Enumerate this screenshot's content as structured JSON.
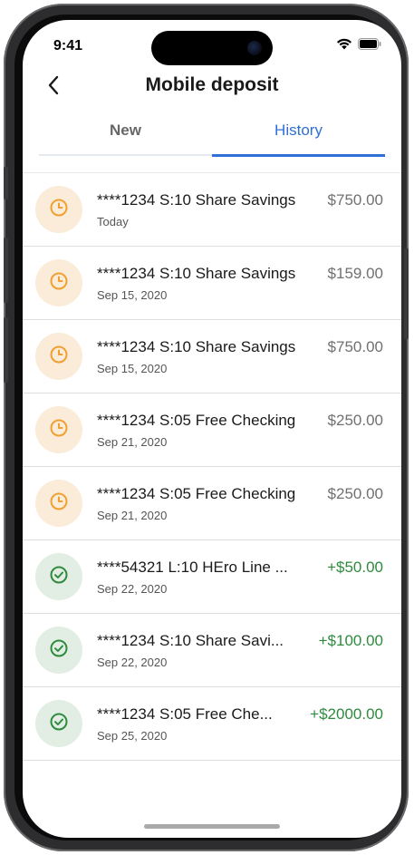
{
  "status_bar": {
    "time": "9:41"
  },
  "header": {
    "title": "Mobile deposit",
    "back_icon": "chevron-left-icon"
  },
  "tabs": [
    {
      "label": "New",
      "active": false
    },
    {
      "label": "History",
      "active": true
    }
  ],
  "colors": {
    "accent": "#2F6FD6",
    "pending_bg": "#fbecd9",
    "pending_icon": "#f0a030",
    "done_bg": "#e2eee3",
    "done_icon": "#2e8b3e",
    "positive_amount": "#2e8b3e",
    "neutral_amount": "#707070"
  },
  "deposits": [
    {
      "status": "pending",
      "icon": "clock-icon",
      "name": "****1234 S:10 Share Savings",
      "date": "Today",
      "amount": "$750.00"
    },
    {
      "status": "pending",
      "icon": "clock-icon",
      "name": "****1234 S:10 Share Savings",
      "date": "Sep 15, 2020",
      "amount": "$159.00"
    },
    {
      "status": "pending",
      "icon": "clock-icon",
      "name": "****1234 S:10 Share Savings",
      "date": "Sep 15, 2020",
      "amount": "$750.00"
    },
    {
      "status": "pending",
      "icon": "clock-icon",
      "name": "****1234 S:05 Free Checking",
      "date": "Sep 21, 2020",
      "amount": "$250.00"
    },
    {
      "status": "pending",
      "icon": "clock-icon",
      "name": "****1234 S:05 Free Checking",
      "date": "Sep 21, 2020",
      "amount": "$250.00"
    },
    {
      "status": "done",
      "icon": "check-circle-icon",
      "name": "****54321 L:10 HEro Line ...",
      "date": "Sep 22, 2020",
      "amount": "+$50.00"
    },
    {
      "status": "done",
      "icon": "check-circle-icon",
      "name": "****1234 S:10 Share Savi...",
      "date": "Sep 22, 2020",
      "amount": "+$100.00"
    },
    {
      "status": "done",
      "icon": "check-circle-icon",
      "name": "****1234 S:05 Free Che...",
      "date": "Sep 25, 2020",
      "amount": "+$2000.00"
    }
  ]
}
